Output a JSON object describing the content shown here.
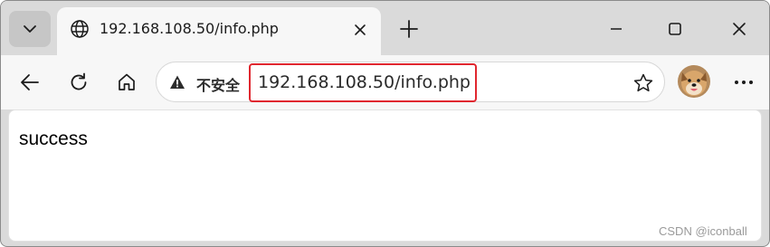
{
  "browser": {
    "tab": {
      "title": "192.168.108.50/info.php",
      "favicon": "globe-icon"
    },
    "controls": {
      "tab_menu": "chevron-down-icon",
      "close_tab": "close-icon",
      "new_tab": "plus-icon",
      "minimize": "minimize-icon",
      "maximize": "maximize-icon",
      "close_window": "close-window-icon"
    },
    "toolbar": {
      "back": "back-arrow-icon",
      "reload": "reload-icon",
      "home": "home-icon",
      "security_label": "不安全",
      "security_icon": "warning-icon",
      "url": "192.168.108.50/info.php",
      "favorite": "star-icon",
      "profile": "avatar",
      "more": "more-icon"
    },
    "highlight_color": "#e0272f"
  },
  "page": {
    "body_text": "success"
  },
  "watermark": "CSDN @iconball"
}
